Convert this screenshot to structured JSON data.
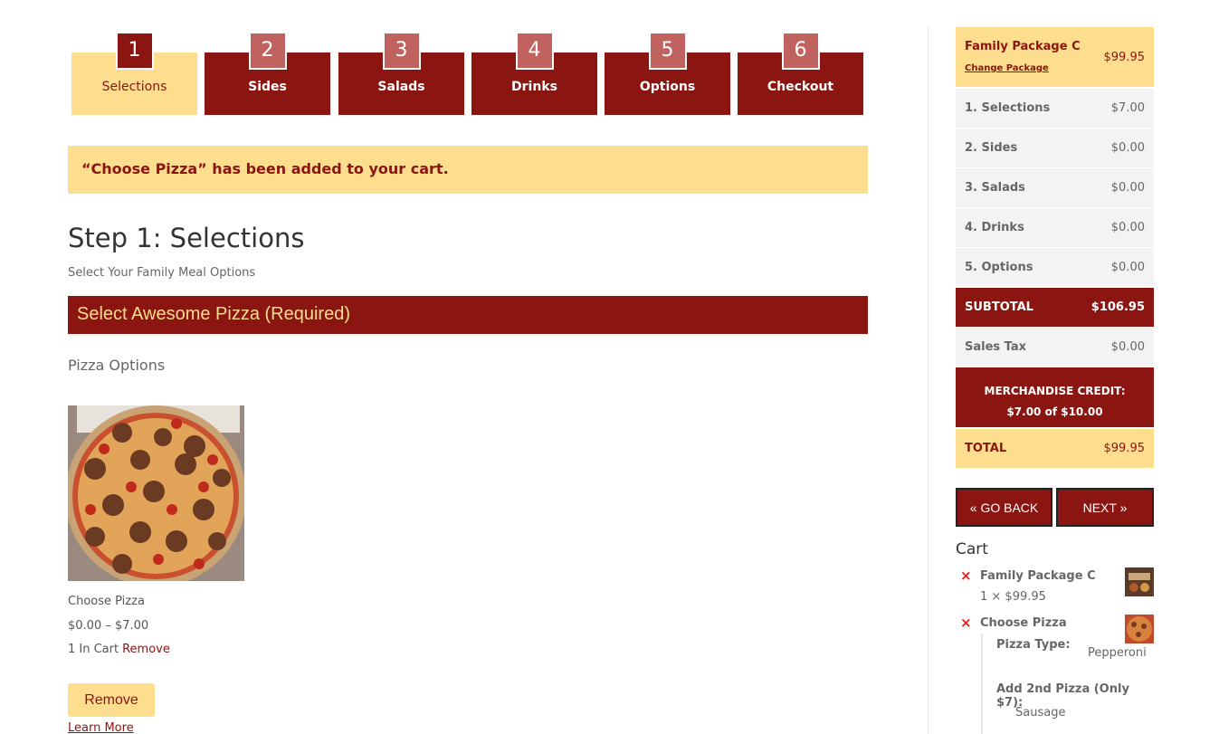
{
  "steps": [
    {
      "num": "1",
      "label": "Selections",
      "active": true
    },
    {
      "num": "2",
      "label": "Sides"
    },
    {
      "num": "3",
      "label": "Salads"
    },
    {
      "num": "4",
      "label": "Drinks"
    },
    {
      "num": "5",
      "label": "Options"
    },
    {
      "num": "6",
      "label": "Checkout"
    }
  ],
  "notice": "“Choose Pizza” has been added to your cart.",
  "page": {
    "title": "Step 1: Selections",
    "subtitle": "Select Your Family Meal Options",
    "section": "Select Awesome Pizza (Required)",
    "options_heading": "Pizza Options"
  },
  "product": {
    "name": "Choose Pizza",
    "price": "$0.00 – $7.00",
    "in_cart": "1 In Cart",
    "remove_link": "Remove",
    "remove_button": "Remove",
    "learn_more": "Learn More"
  },
  "summary": {
    "package_name": "Family Package C",
    "change_package": "Change Package",
    "package_price": "$99.95",
    "rows": [
      {
        "label": "1. Selections",
        "value": "$7.00"
      },
      {
        "label": "2. Sides",
        "value": "$0.00"
      },
      {
        "label": "3. Salads",
        "value": "$0.00"
      },
      {
        "label": "4. Drinks",
        "value": "$0.00"
      },
      {
        "label": "5. Options",
        "value": "$0.00"
      }
    ],
    "subtotal_label": "SUBTOTAL",
    "subtotal_value": "$106.95",
    "tax_label": "Sales Tax",
    "tax_value": "$0.00",
    "credit_label": "MERCHANDISE CREDIT:",
    "credit_value": "$7.00 of $10.00",
    "total_label": "TOTAL",
    "total_value": "$99.95"
  },
  "nav": {
    "back": "« GO BACK",
    "next": "NEXT »"
  },
  "cart": {
    "title": "Cart",
    "remove_symbol": "×",
    "items": [
      {
        "name": "Family Package C",
        "qty": "1 × $99.95"
      },
      {
        "name": "Choose Pizza"
      }
    ],
    "meta": [
      {
        "key": "Pizza Type:",
        "value": "Pepperoni"
      },
      {
        "key": "Add 2nd Pizza (Only $7):",
        "value": "Sausage"
      }
    ]
  },
  "colors": {
    "primary": "#8b1511",
    "accent": "#fddd8e",
    "remove_x": "#e2221b"
  }
}
